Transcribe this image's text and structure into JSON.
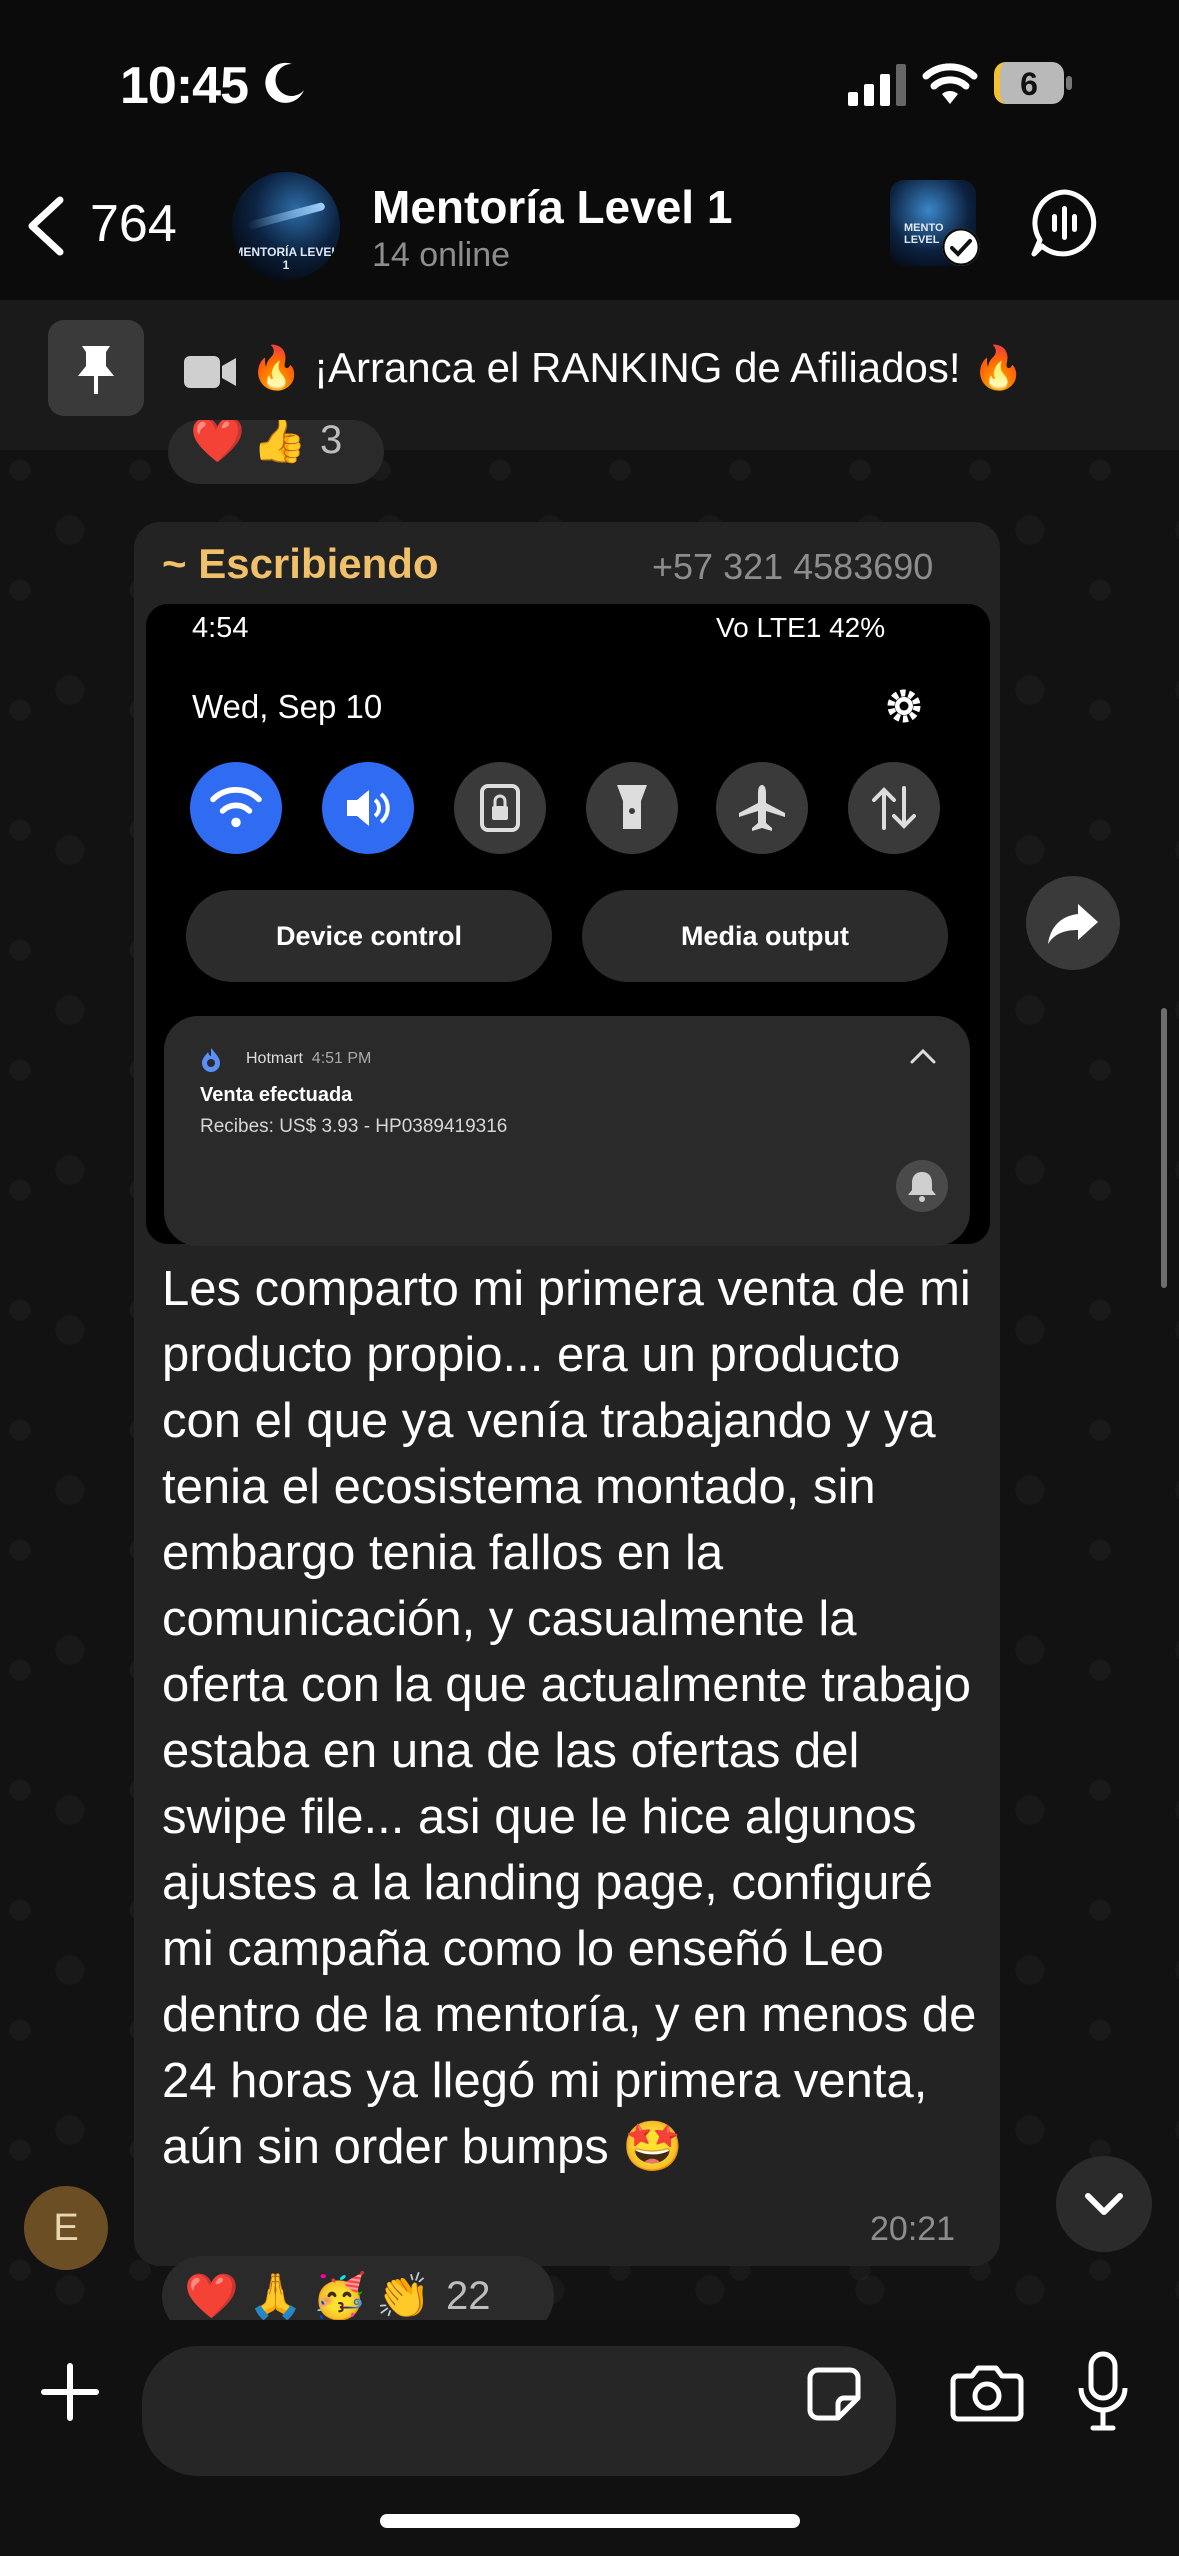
{
  "status_bar": {
    "time": "10:45",
    "battery": "6"
  },
  "header": {
    "back_count": "764",
    "title": "Mentoría Level 1",
    "subtitle": "14 online",
    "avatar_text": "MENTORÍA LEVEL 1",
    "call_avatar_text": "MENTO LEVEL"
  },
  "pinned": {
    "text": "🔥 ¡Arranca el RANKING de Afiliados! 🔥"
  },
  "reactions_top": {
    "emojis": [
      "❤️",
      "👍"
    ],
    "count": "3"
  },
  "message": {
    "sender_name": "~ Escribiendo",
    "sender_phone": "+57 321 4583690",
    "text": "Les comparto mi primera venta de mi producto propio... era un producto con el que ya venía trabajando y ya tenia el ecosistema montado, sin embargo tenia fallos en la comunicación, y casualmente la oferta con la que actualmente trabajo estaba en una de las ofertas del swipe file... asi que le hice algunos ajustes a la landing page, configuré mi campaña como lo enseñó Leo dentro de la mentoría, y en menos de 24 horas ya llegó mi primera venta, aún sin order bumps 🤩",
    "time": "20:21",
    "sender_avatar_letter": "E"
  },
  "screenshot": {
    "time": "4:54",
    "status": "Vo LTE1 42%",
    "date": "Wed, Sep 10",
    "device_control": "Device control",
    "media_output": "Media output",
    "notification": {
      "app": "Hotmart",
      "time": "4:51 PM",
      "title": "Venta efectuada",
      "body": "Recibes: US$ 3.93 - HP0389419316"
    }
  },
  "reactions_bottom": {
    "emojis": [
      "❤️",
      "🙏",
      "🥳",
      "👏"
    ],
    "count": "22"
  },
  "input": {
    "placeholder": ""
  }
}
